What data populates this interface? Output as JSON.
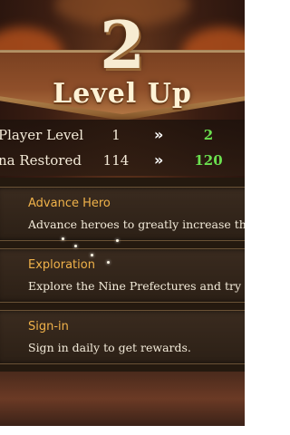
{
  "header": {
    "level_number": "2",
    "title": "Level Up"
  },
  "stats": [
    {
      "label": "Player Level",
      "from": "1",
      "to": "2"
    },
    {
      "label": "na Restored",
      "from": "114",
      "to": "120"
    }
  ],
  "arrow_glyph": "»",
  "cards": [
    {
      "name": "Advance Hero",
      "desc": "Advance heroes to greatly increase th"
    },
    {
      "name": "Exploration",
      "desc": "Explore the Nine Prefectures and try"
    },
    {
      "name": "Sign-in",
      "desc": "Sign in daily to get rewards."
    }
  ],
  "colors": {
    "gain": "#6be04f",
    "card_title": "#f0b24a"
  }
}
